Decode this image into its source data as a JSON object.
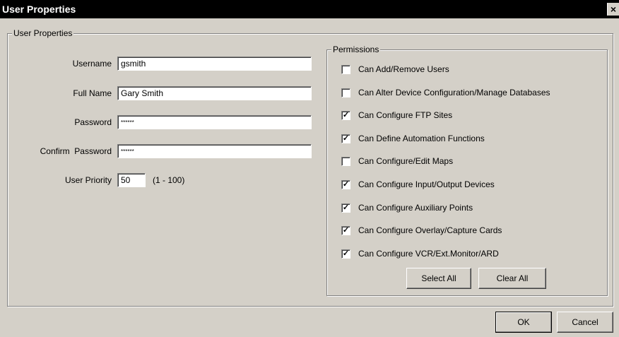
{
  "window": {
    "title": "User Properties",
    "close_glyph": "×"
  },
  "user_group": {
    "label": "User Properties"
  },
  "fields": {
    "username": {
      "label": "Username",
      "value": "gsmith"
    },
    "full_name": {
      "label": "Full Name",
      "value": "Gary Smith"
    },
    "password": {
      "label": "Password",
      "value": "******"
    },
    "confirm_password": {
      "label": "Confirm  Password",
      "value": "******"
    },
    "priority": {
      "label": "User Priority",
      "value": "50",
      "range": "(1 - 100)"
    }
  },
  "permissions": {
    "label": "Permissions",
    "items": [
      {
        "label": "Can Add/Remove Users",
        "checked": false
      },
      {
        "label": "Can Alter Device Configuration/Manage Databases",
        "checked": false
      },
      {
        "label": "Can Configure FTP Sites",
        "checked": true
      },
      {
        "label": "Can Define Automation Functions",
        "checked": true
      },
      {
        "label": "Can Configure/Edit Maps",
        "checked": false
      },
      {
        "label": "Can Configure Input/Output Devices",
        "checked": true
      },
      {
        "label": "Can Configure Auxiliary Points",
        "checked": true
      },
      {
        "label": "Can Configure Overlay/Capture Cards",
        "checked": true
      },
      {
        "label": "Can Configure VCR/Ext.Monitor/ARD",
        "checked": true
      }
    ],
    "select_all_label": "Select All",
    "clear_all_label": "Clear All"
  },
  "footer": {
    "ok_label": "OK",
    "cancel_label": "Cancel"
  },
  "check_glyph": "✓"
}
